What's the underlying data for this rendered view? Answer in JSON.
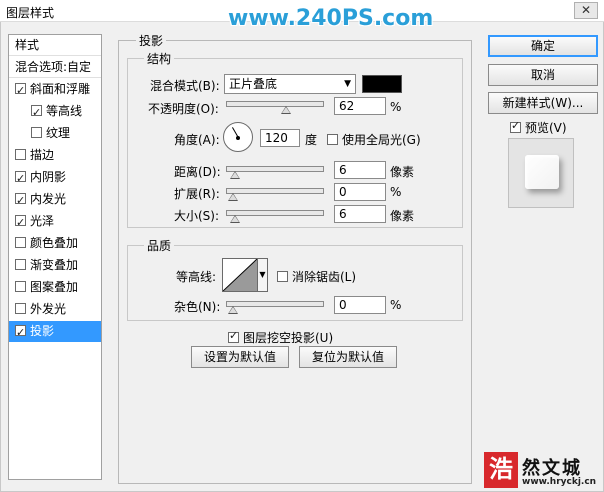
{
  "window": {
    "title": "图层样式",
    "close_glyph": "✕",
    "watermark": "www.240PS.com"
  },
  "left_list": {
    "header": "样式",
    "blend_options": "混合选项:自定",
    "items": [
      {
        "label": "斜面和浮雕",
        "checked": true,
        "indent": false
      },
      {
        "label": "等高线",
        "checked": true,
        "indent": true
      },
      {
        "label": "纹理",
        "checked": false,
        "indent": true
      },
      {
        "label": "描边",
        "checked": false,
        "indent": false
      },
      {
        "label": "内阴影",
        "checked": true,
        "indent": false
      },
      {
        "label": "内发光",
        "checked": true,
        "indent": false
      },
      {
        "label": "光泽",
        "checked": true,
        "indent": false
      },
      {
        "label": "颜色叠加",
        "checked": false,
        "indent": false
      },
      {
        "label": "渐变叠加",
        "checked": false,
        "indent": false
      },
      {
        "label": "图案叠加",
        "checked": false,
        "indent": false
      },
      {
        "label": "外发光",
        "checked": false,
        "indent": false
      },
      {
        "label": "投影",
        "checked": true,
        "indent": false,
        "selected": true
      }
    ]
  },
  "panel": {
    "title": "投影",
    "structure": {
      "title": "结构",
      "blend_mode_label": "混合模式(B):",
      "blend_mode_value": "正片叠底",
      "shadow_color": "#000000",
      "opacity_label": "不透明度(O):",
      "opacity_value": "62",
      "opacity_unit": "%",
      "opacity_fraction": 0.62,
      "angle_label": "角度(A):",
      "angle_value": "120",
      "angle_unit": "度",
      "global_light_label": "使用全局光(G)",
      "global_light_checked": false,
      "distance_label": "距离(D):",
      "distance_value": "6",
      "distance_unit": "像素",
      "distance_fraction": 0.02,
      "spread_label": "扩展(R):",
      "spread_value": "0",
      "spread_unit": "%",
      "spread_fraction": 0.0,
      "size_label": "大小(S):",
      "size_value": "6",
      "size_unit": "像素",
      "size_fraction": 0.02
    },
    "quality": {
      "title": "品质",
      "contour_label": "等高线:",
      "anti_alias_label": "消除锯齿(L)",
      "anti_alias_checked": false,
      "noise_label": "杂色(N):",
      "noise_value": "0",
      "noise_unit": "%",
      "noise_fraction": 0.0
    },
    "knockout_label": "图层挖空投影(U)",
    "knockout_checked": true,
    "make_default": "设置为默认值",
    "reset_default": "复位为默认值"
  },
  "buttons": {
    "ok": "确定",
    "cancel": "取消",
    "new_style": "新建样式(W)...",
    "preview_label": "预览(V)",
    "preview_checked": true
  },
  "brand": {
    "mark": "浩",
    "name": "然文城",
    "url": "www.hryckj.cn",
    "mark_color": "#d8282c"
  },
  "colors": {
    "selection": "#3399ff",
    "watermark": "#2a9fd8"
  }
}
